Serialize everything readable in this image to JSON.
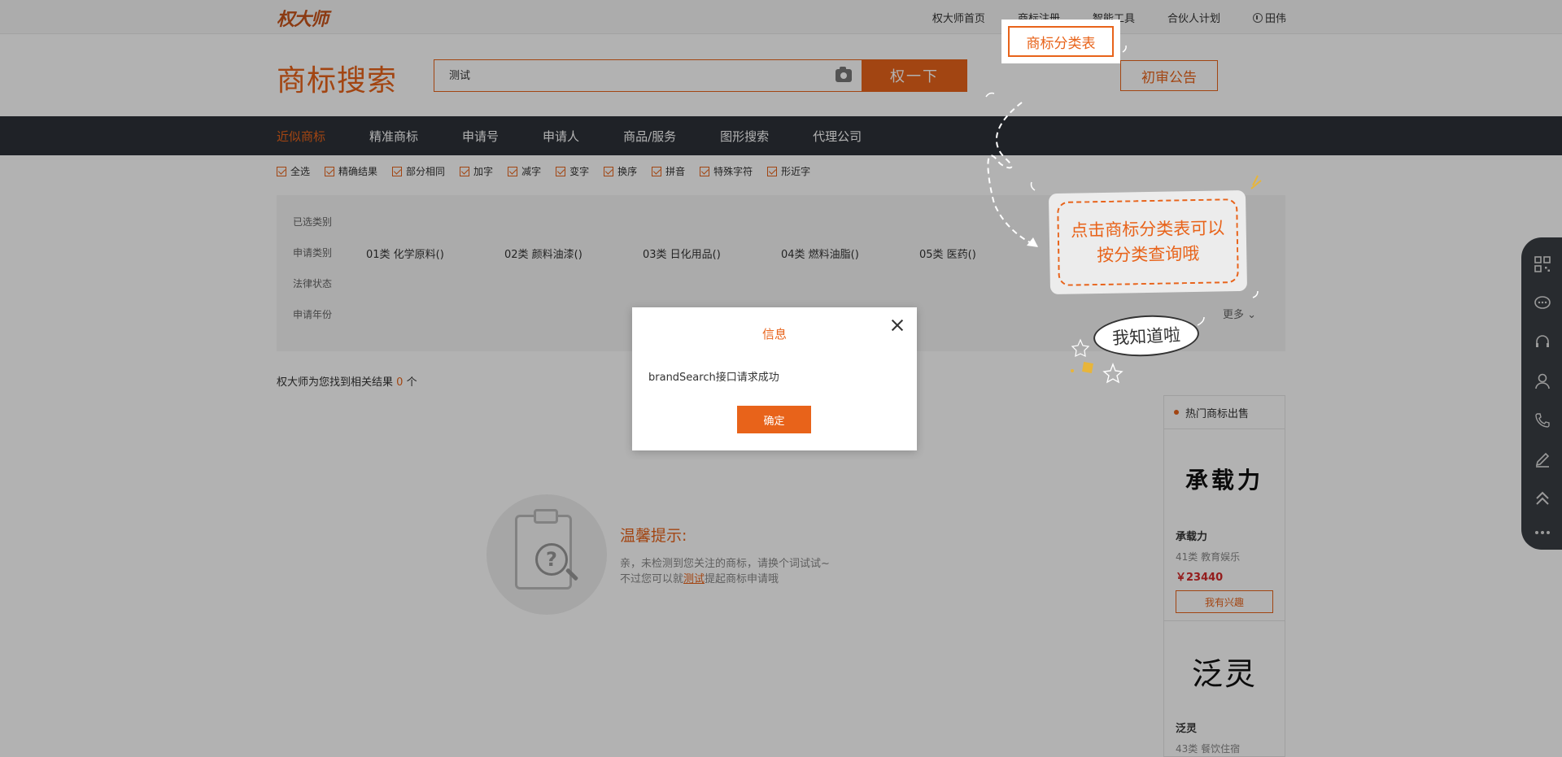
{
  "topbar": {
    "logo": "权大师",
    "nav": [
      "权大师首页",
      "商标注册",
      "智能工具",
      "合伙人计划"
    ],
    "user": "田伟"
  },
  "header": {
    "title": "商标搜索",
    "search_value": "测试",
    "search_button": "权一下",
    "category_button": "商标分类表",
    "notice_button": "初审公告"
  },
  "nav": {
    "items": [
      "近似商标",
      "精准商标",
      "申请号",
      "申请人",
      "商品/服务",
      "图形搜索",
      "代理公司"
    ],
    "active_index": 0
  },
  "filters": [
    "全选",
    "精确结果",
    "部分相同",
    "加字",
    "减字",
    "变字",
    "换序",
    "拼音",
    "特殊字符",
    "形近字"
  ],
  "category_panel": {
    "selected_label": "已选类别",
    "apply_class_label": "申请类别",
    "classes": [
      "01类 化学原料()",
      "02类 颜料油漆()",
      "03类 日化用品()",
      "04类 燃料油脂()",
      "05类 医药()"
    ],
    "legal_status_label": "法律状态",
    "apply_year_label": "申请年份",
    "more": "更多"
  },
  "results": {
    "prefix": "权大师为您找到相关结果",
    "count": "0",
    "suffix": "个"
  },
  "empty_tip": {
    "title": "温馨提示:",
    "line1": "亲，未检测到您关注的商标，请换个词试试~",
    "line2_prefix": "不过您可以就",
    "keyword": "测试",
    "line2_suffix": "提起商标申请哦"
  },
  "hot_sale": {
    "title": "热门商标出售",
    "cards": [
      {
        "logo_text": "承载力",
        "name": "承载力",
        "class": "41类 教育娱乐",
        "price": "￥23440",
        "button": "我有兴趣"
      },
      {
        "logo_text": "泛灵",
        "name": "泛灵",
        "class": "43类 餐饮住宿"
      }
    ]
  },
  "guide": {
    "text": "点击商标分类表可以按分类查询哦",
    "ok_button": "我知道啦"
  },
  "dialog": {
    "title": "信息",
    "message": "brandSearch接口请求成功",
    "confirm": "确定"
  },
  "float_toolbar": [
    "qrcode-icon",
    "chat-icon",
    "headset-icon",
    "user-icon",
    "phone-icon",
    "edit-icon",
    "back-to-top-icon",
    "more-icon"
  ],
  "colors": {
    "accent": "#e8631a",
    "nav_bg": "#2d3239",
    "price": "#d42a2a"
  }
}
